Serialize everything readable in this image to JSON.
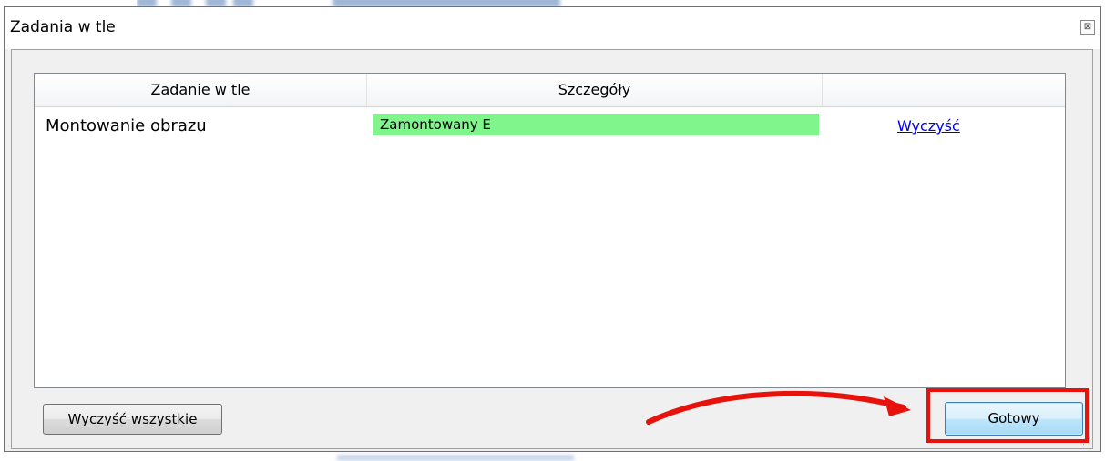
{
  "dialog": {
    "title": "Zadania w tle",
    "close_glyph": "⊠"
  },
  "list": {
    "columns": [
      "Zadanie w tle",
      "Szczegóły",
      ""
    ],
    "rows": [
      {
        "task": "Montowanie obrazu",
        "details": "Zamontowany E",
        "progress_fraction": 1.0,
        "action_link": "Wyczyść"
      }
    ]
  },
  "buttons": {
    "clear_all": "Wyczyść wszystkie",
    "done": "Gotowy"
  },
  "colors": {
    "progress_fill": "#7ff58c",
    "link": "#0000ee",
    "annotation": "#e8120c"
  },
  "icons": {
    "close": "close-icon",
    "resize": "resize-grip-icon"
  }
}
